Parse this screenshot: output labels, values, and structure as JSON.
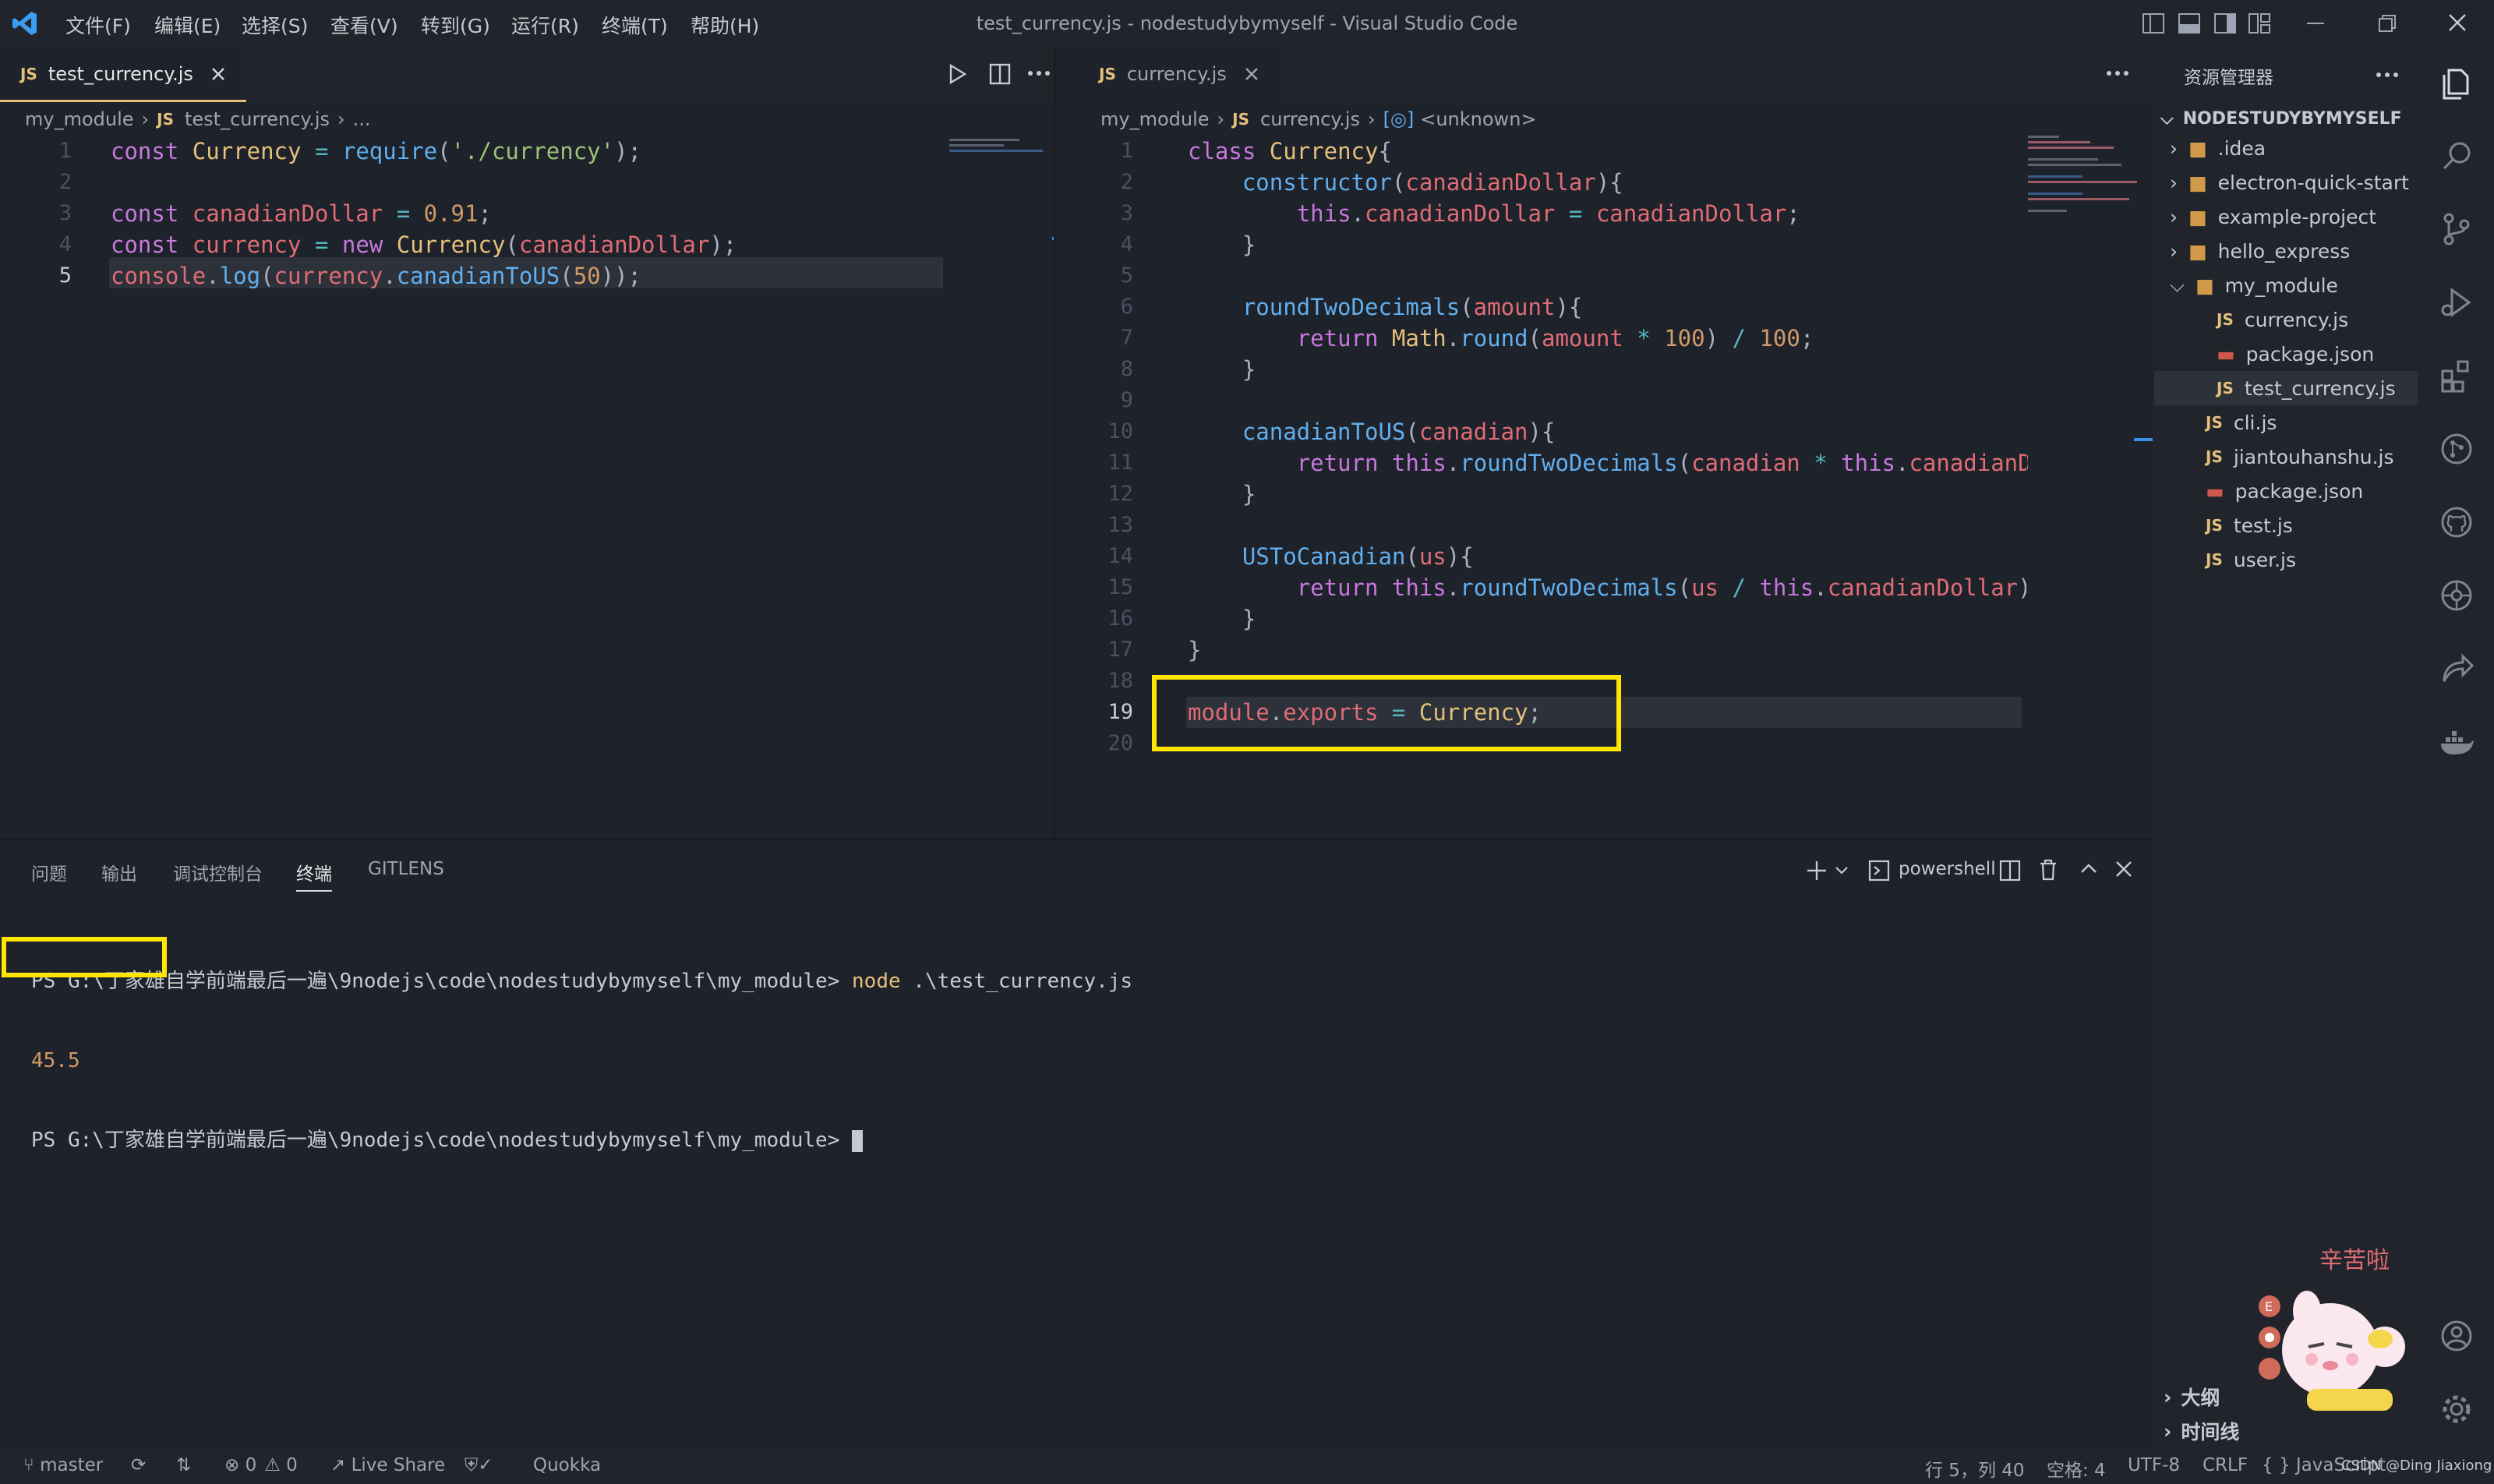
{
  "window": {
    "title": "test_currency.js - nodestudybymyself - Visual Studio Code",
    "menu": [
      "文件(F)",
      "编辑(E)",
      "选择(S)",
      "查看(V)",
      "转到(G)",
      "运行(R)",
      "终端(T)",
      "帮助(H)"
    ]
  },
  "left_editor": {
    "tab": {
      "badge": "JS",
      "label": "test_currency.js"
    },
    "breadcrumb": {
      "folder": "my_module",
      "badge": "JS",
      "file": "test_currency.js",
      "more": "..."
    },
    "line_numbers": [
      "1",
      "2",
      "3",
      "4",
      "5"
    ],
    "current_line": 5
  },
  "right_editor": {
    "tab": {
      "badge": "JS",
      "label": "currency.js"
    },
    "breadcrumb": {
      "folder": "my_module",
      "badge": "JS",
      "file": "currency.js",
      "symbol": "<unknown>"
    },
    "line_numbers": [
      "1",
      "2",
      "3",
      "4",
      "5",
      "6",
      "7",
      "8",
      "9",
      "10",
      "11",
      "12",
      "13",
      "14",
      "15",
      "16",
      "17",
      "18",
      "19",
      "20"
    ],
    "current_line": 19
  },
  "explorer": {
    "title": "资源管理器",
    "root": "NODESTUDYBYMYSELF",
    "items": [
      {
        "label": ".idea",
        "kind": "folder"
      },
      {
        "label": "electron-quick-start",
        "kind": "folder"
      },
      {
        "label": "example-project",
        "kind": "folder"
      },
      {
        "label": "hello_express",
        "kind": "folder"
      },
      {
        "label": "my_module",
        "kind": "folder-open"
      },
      {
        "label": "currency.js",
        "kind": "js"
      },
      {
        "label": "package.json",
        "kind": "json"
      },
      {
        "label": "test_currency.js",
        "kind": "js"
      },
      {
        "label": "cli.js",
        "kind": "js"
      },
      {
        "label": "jiantouhanshu.js",
        "kind": "js"
      },
      {
        "label": "package.json",
        "kind": "json"
      },
      {
        "label": "test.js",
        "kind": "js"
      },
      {
        "label": "user.js",
        "kind": "js"
      }
    ],
    "outline": "大纲",
    "timeline": "时间线",
    "sticker_text": "辛苦啦"
  },
  "panel": {
    "tabs": [
      "问题",
      "输出",
      "调试控制台",
      "终端",
      "GITLENS"
    ],
    "active_tab": "终端",
    "shell": "powershell",
    "terminal": {
      "prompt1": "PS G:\\丁家雄自学前端最后一遍\\9nodejs\\code\\nodestudybymyself\\my_module> ",
      "cmd_node": "node",
      "cmd_arg": " .\\test_currency.js",
      "output": "45.5",
      "prompt2": "PS G:\\丁家雄自学前端最后一遍\\9nodejs\\code\\nodestudybymyself\\my_module> "
    }
  },
  "statusbar": {
    "branch": "master",
    "errors": "0",
    "warnings": "0",
    "live_share": "Live Share",
    "quokka": "Quokka",
    "position": "行 5，列 40",
    "spaces": "空格: 4",
    "encoding": "UTF-8",
    "eol": "CRLF",
    "language": "JavaScript",
    "watermark": "CSDN @Ding Jiaxiong"
  },
  "colors": {
    "highlight": "#ffe600",
    "accent": "#e5c07b",
    "background": "#1e222a"
  }
}
